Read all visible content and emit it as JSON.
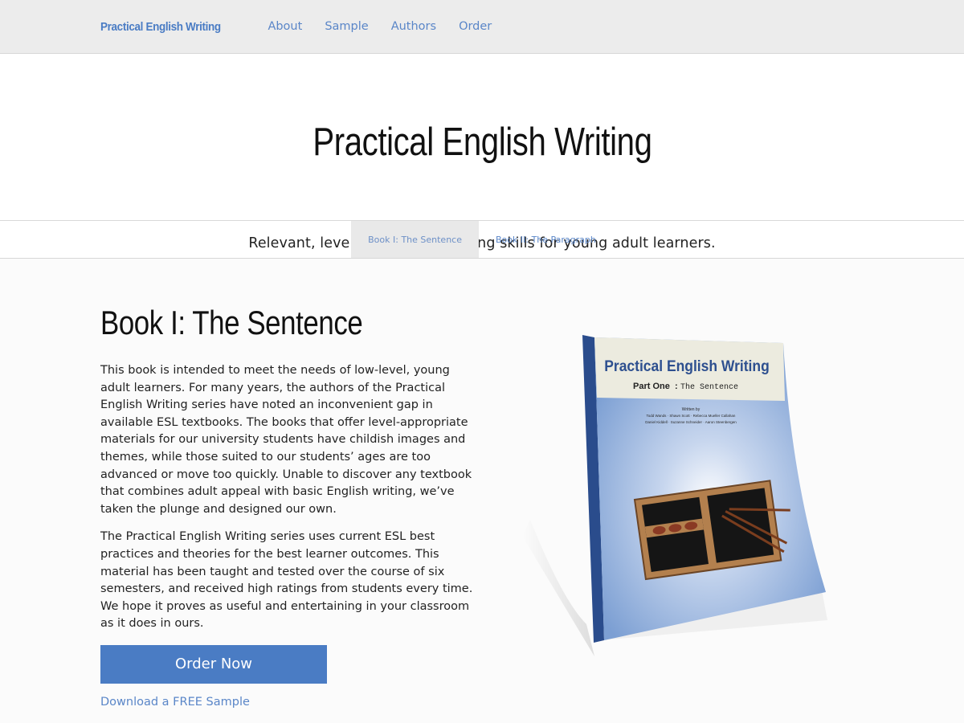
{
  "nav": {
    "brand": "Practical English Writing",
    "links": [
      "About",
      "Sample",
      "Authors",
      "Order"
    ]
  },
  "hero": {
    "title": "Practical English Writing",
    "subtitle": "Relevant, level-appropriate writing skills for young adult learners."
  },
  "tabs": [
    {
      "label": "Book I: The Sentence",
      "active": true
    },
    {
      "label": "Book II: The Paragraph",
      "active": false
    }
  ],
  "book": {
    "heading": "Book I: The Sentence",
    "paragraphs": [
      "This book is intended to meet the needs of low-level, young adult learners. For many years, the authors of the Practical English Writing series have noted an inconvenient gap in available ESL textbooks. The books that offer level-appropriate materials for our university students have childish images and themes, while those suited to our students’ ages are too advanced or move too quickly. Unable to discover any textbook that combines adult appeal with basic English writing, we’ve taken the plunge and designed our own.",
      "The Practical English Writing series uses current ESL best practices and theories for the best learner outcomes. This material has been taught and tested over the course of six semesters, and received high ratings from students every time. We hope it proves as useful and entertaining in your classroom as it does in ours."
    ],
    "order_label": "Order Now",
    "sample_label": "Download a FREE Sample"
  },
  "cover": {
    "title": "Practical English Writing",
    "part": "Part One",
    "subtitle": "The Sentence",
    "written_by": "Written by",
    "authors_line1": "Todd Wands · Shawn Scott · Rebecca Mueller Callahan",
    "authors_line2": "Daniel Kiddell · Suzanne Schneider · Aaron Steenbergen"
  },
  "colors": {
    "accent": "#4a7cc4",
    "link": "#5a86c8",
    "cover_blue": "#7ea0d2",
    "spine": "#2a4c8c"
  }
}
